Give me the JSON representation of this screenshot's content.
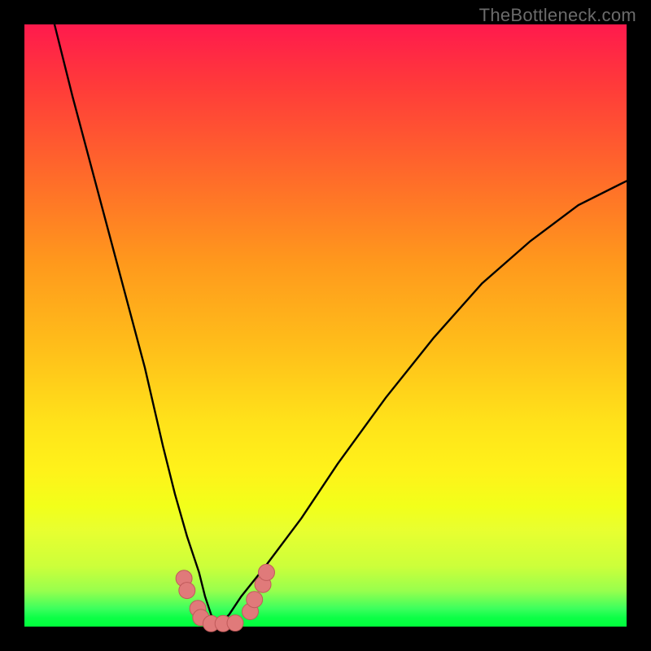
{
  "watermark": "TheBottleneck.com",
  "colors": {
    "page_bg": "#000000",
    "gradient_top": "#ff1a4d",
    "gradient_bottom": "#00ff3c",
    "curve": "#000000",
    "marker_fill": "#e07a7a",
    "marker_stroke": "#c05a5a"
  },
  "chart_data": {
    "type": "line",
    "title": "",
    "xlabel": "",
    "ylabel": "",
    "xlim": [
      0,
      100
    ],
    "ylim": [
      0,
      100
    ],
    "note": "Axes have no visible tick labels; x/y values are approximate pixel-normalized percentages read from the figure. Higher y = higher on screen. Minimum of the curve is near x≈32, y≈0.",
    "series": [
      {
        "name": "left-branch",
        "x": [
          5,
          8,
          12,
          16,
          20,
          23,
          25,
          27,
          29,
          30,
          31,
          32
        ],
        "y": [
          100,
          88,
          73,
          58,
          43,
          30,
          22,
          15,
          9,
          5,
          2,
          0
        ]
      },
      {
        "name": "right-branch",
        "x": [
          32,
          34,
          36,
          40,
          46,
          52,
          60,
          68,
          76,
          84,
          92,
          100
        ],
        "y": [
          0,
          2,
          5,
          10,
          18,
          27,
          38,
          48,
          57,
          64,
          70,
          74
        ]
      }
    ],
    "markers": {
      "name": "bottom-cluster",
      "points": [
        {
          "x": 26.5,
          "y": 8.0
        },
        {
          "x": 27.0,
          "y": 6.0
        },
        {
          "x": 28.8,
          "y": 3.0
        },
        {
          "x": 29.3,
          "y": 1.5
        },
        {
          "x": 31.0,
          "y": 0.5
        },
        {
          "x": 33.0,
          "y": 0.5
        },
        {
          "x": 35.0,
          "y": 0.6
        },
        {
          "x": 37.5,
          "y": 2.5
        },
        {
          "x": 38.2,
          "y": 4.5
        },
        {
          "x": 39.6,
          "y": 7.0
        },
        {
          "x": 40.2,
          "y": 9.0
        }
      ],
      "radius_pct": 1.35
    }
  }
}
